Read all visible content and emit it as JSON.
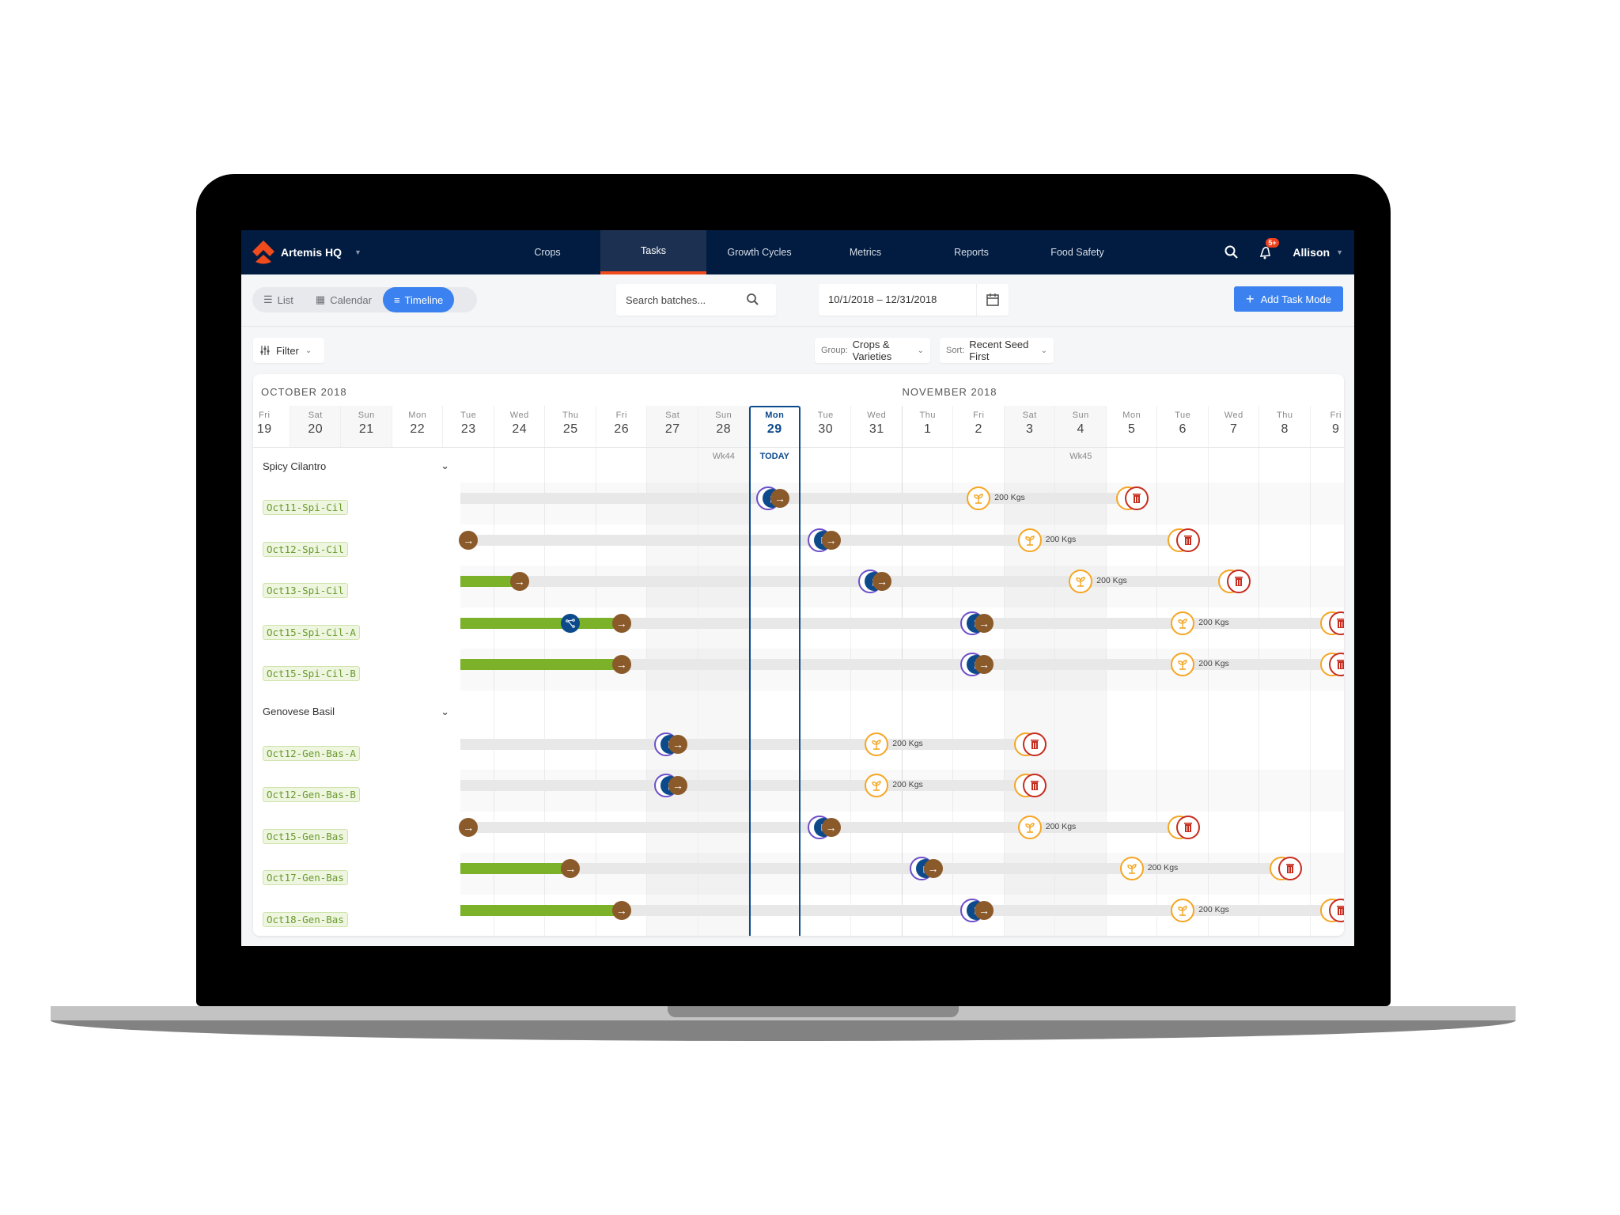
{
  "nav": {
    "brand": "Artemis HQ",
    "tabs": [
      {
        "label": "Crops",
        "active": false
      },
      {
        "label": "Tasks",
        "active": true
      },
      {
        "label": "Growth Cycles",
        "active": false
      },
      {
        "label": "Metrics",
        "active": false
      },
      {
        "label": "Reports",
        "active": false
      },
      {
        "label": "Food Safety",
        "active": false
      }
    ],
    "notification_badge": "5+",
    "user": "Allison"
  },
  "toolbar": {
    "views": [
      {
        "label": "List",
        "icon": "list-icon",
        "active": false
      },
      {
        "label": "Calendar",
        "icon": "calendar-icon",
        "active": false
      },
      {
        "label": "Timeline",
        "icon": "timeline-icon",
        "active": true
      }
    ],
    "search_placeholder": "Search batches...",
    "date_range": "10/1/2018 – 12/31/2018",
    "add_button": "Add Task Mode"
  },
  "filters": {
    "filter_label": "Filter",
    "group_label": "Group:",
    "group_value": "Crops & Varieties",
    "sort_label": "Sort:",
    "sort_value": "Recent Seed First"
  },
  "timeline": {
    "months": [
      {
        "label": "OCTOBER 2018",
        "start_day_index": 0
      },
      {
        "label": "NOVEMBER 2018",
        "start_day_index": 13
      }
    ],
    "days": [
      {
        "dow": "Fri",
        "num": "19",
        "weekend": false
      },
      {
        "dow": "Sat",
        "num": "20",
        "weekend": true
      },
      {
        "dow": "Sun",
        "num": "21",
        "weekend": true
      },
      {
        "dow": "Mon",
        "num": "22",
        "weekend": false
      },
      {
        "dow": "Tue",
        "num": "23",
        "weekend": false
      },
      {
        "dow": "Wed",
        "num": "24",
        "weekend": false
      },
      {
        "dow": "Thu",
        "num": "25",
        "weekend": false
      },
      {
        "dow": "Fri",
        "num": "26",
        "weekend": false
      },
      {
        "dow": "Sat",
        "num": "27",
        "weekend": true
      },
      {
        "dow": "Sun",
        "num": "28",
        "weekend": true,
        "week": "Wk44"
      },
      {
        "dow": "Mon",
        "num": "29",
        "weekend": false,
        "today": true
      },
      {
        "dow": "Tue",
        "num": "30",
        "weekend": false
      },
      {
        "dow": "Wed",
        "num": "31",
        "weekend": false
      },
      {
        "dow": "Thu",
        "num": "1",
        "weekend": false
      },
      {
        "dow": "Fri",
        "num": "2",
        "weekend": false
      },
      {
        "dow": "Sat",
        "num": "3",
        "weekend": true
      },
      {
        "dow": "Sun",
        "num": "4",
        "weekend": true,
        "week": "Wk45"
      },
      {
        "dow": "Mon",
        "num": "5",
        "weekend": false
      },
      {
        "dow": "Tue",
        "num": "6",
        "weekend": false
      },
      {
        "dow": "Wed",
        "num": "7",
        "weekend": false
      },
      {
        "dow": "Thu",
        "num": "8",
        "weekend": false
      },
      {
        "dow": "Fri",
        "num": "9",
        "weekend": false
      }
    ],
    "today_label": "TODAY",
    "harvest_amount": "200 Kgs",
    "groups": [
      {
        "name": "Spicy Cilantro",
        "batches": [
          {
            "id": "Oct11-Spi-Cil",
            "grow_until": null,
            "branch": null,
            "cycle": 10.45,
            "harvest": 14.5,
            "trash": 17.6
          },
          {
            "id": "Oct12-Spi-Cil",
            "grow_until": 4.5,
            "branch": null,
            "cycle": 11.45,
            "harvest": 15.5,
            "trash": 18.6
          },
          {
            "id": "Oct13-Spi-Cil",
            "grow_until": 5.5,
            "branch": null,
            "cycle": 12.45,
            "harvest": 16.5,
            "trash": 19.6
          },
          {
            "id": "Oct15-Spi-Cil-A",
            "grow_until": 7.5,
            "branch": 6.5,
            "cycle": 14.45,
            "harvest": 18.5,
            "trash": 21.6
          },
          {
            "id": "Oct15-Spi-Cil-B",
            "grow_until": 7.5,
            "branch": null,
            "cycle": 14.45,
            "harvest": 18.5,
            "trash": 21.6
          }
        ]
      },
      {
        "name": "Genovese Basil",
        "batches": [
          {
            "id": "Oct12-Gen-Bas-A",
            "grow_until": null,
            "branch": null,
            "cycle": 8.45,
            "harvest": 12.5,
            "trash": 15.6
          },
          {
            "id": "Oct12-Gen-Bas-B",
            "grow_until": null,
            "branch": null,
            "cycle": 8.45,
            "harvest": 12.5,
            "trash": 15.6
          },
          {
            "id": "Oct15-Gen-Bas",
            "grow_until": 4.5,
            "branch": null,
            "cycle": 11.45,
            "harvest": 15.5,
            "trash": 18.6
          },
          {
            "id": "Oct17-Gen-Bas",
            "grow_until": 6.5,
            "branch": null,
            "cycle": 13.45,
            "harvest": 17.5,
            "trash": 20.6
          },
          {
            "id": "Oct18-Gen-Bas",
            "grow_until": 7.5,
            "branch": null,
            "cycle": 14.45,
            "harvest": 18.5,
            "trash": 21.6
          }
        ]
      }
    ]
  },
  "colors": {
    "nav_bg": "#011c40",
    "accent_blue": "#3b82f0",
    "active_tab_underline": "#f04a1d",
    "today_blue": "#0c4a8c",
    "grow_green": "#7bb22a",
    "transfer_brown": "#8b5a2b",
    "harvest_orange": "#f5a623",
    "trash_red": "#c62c1e"
  }
}
